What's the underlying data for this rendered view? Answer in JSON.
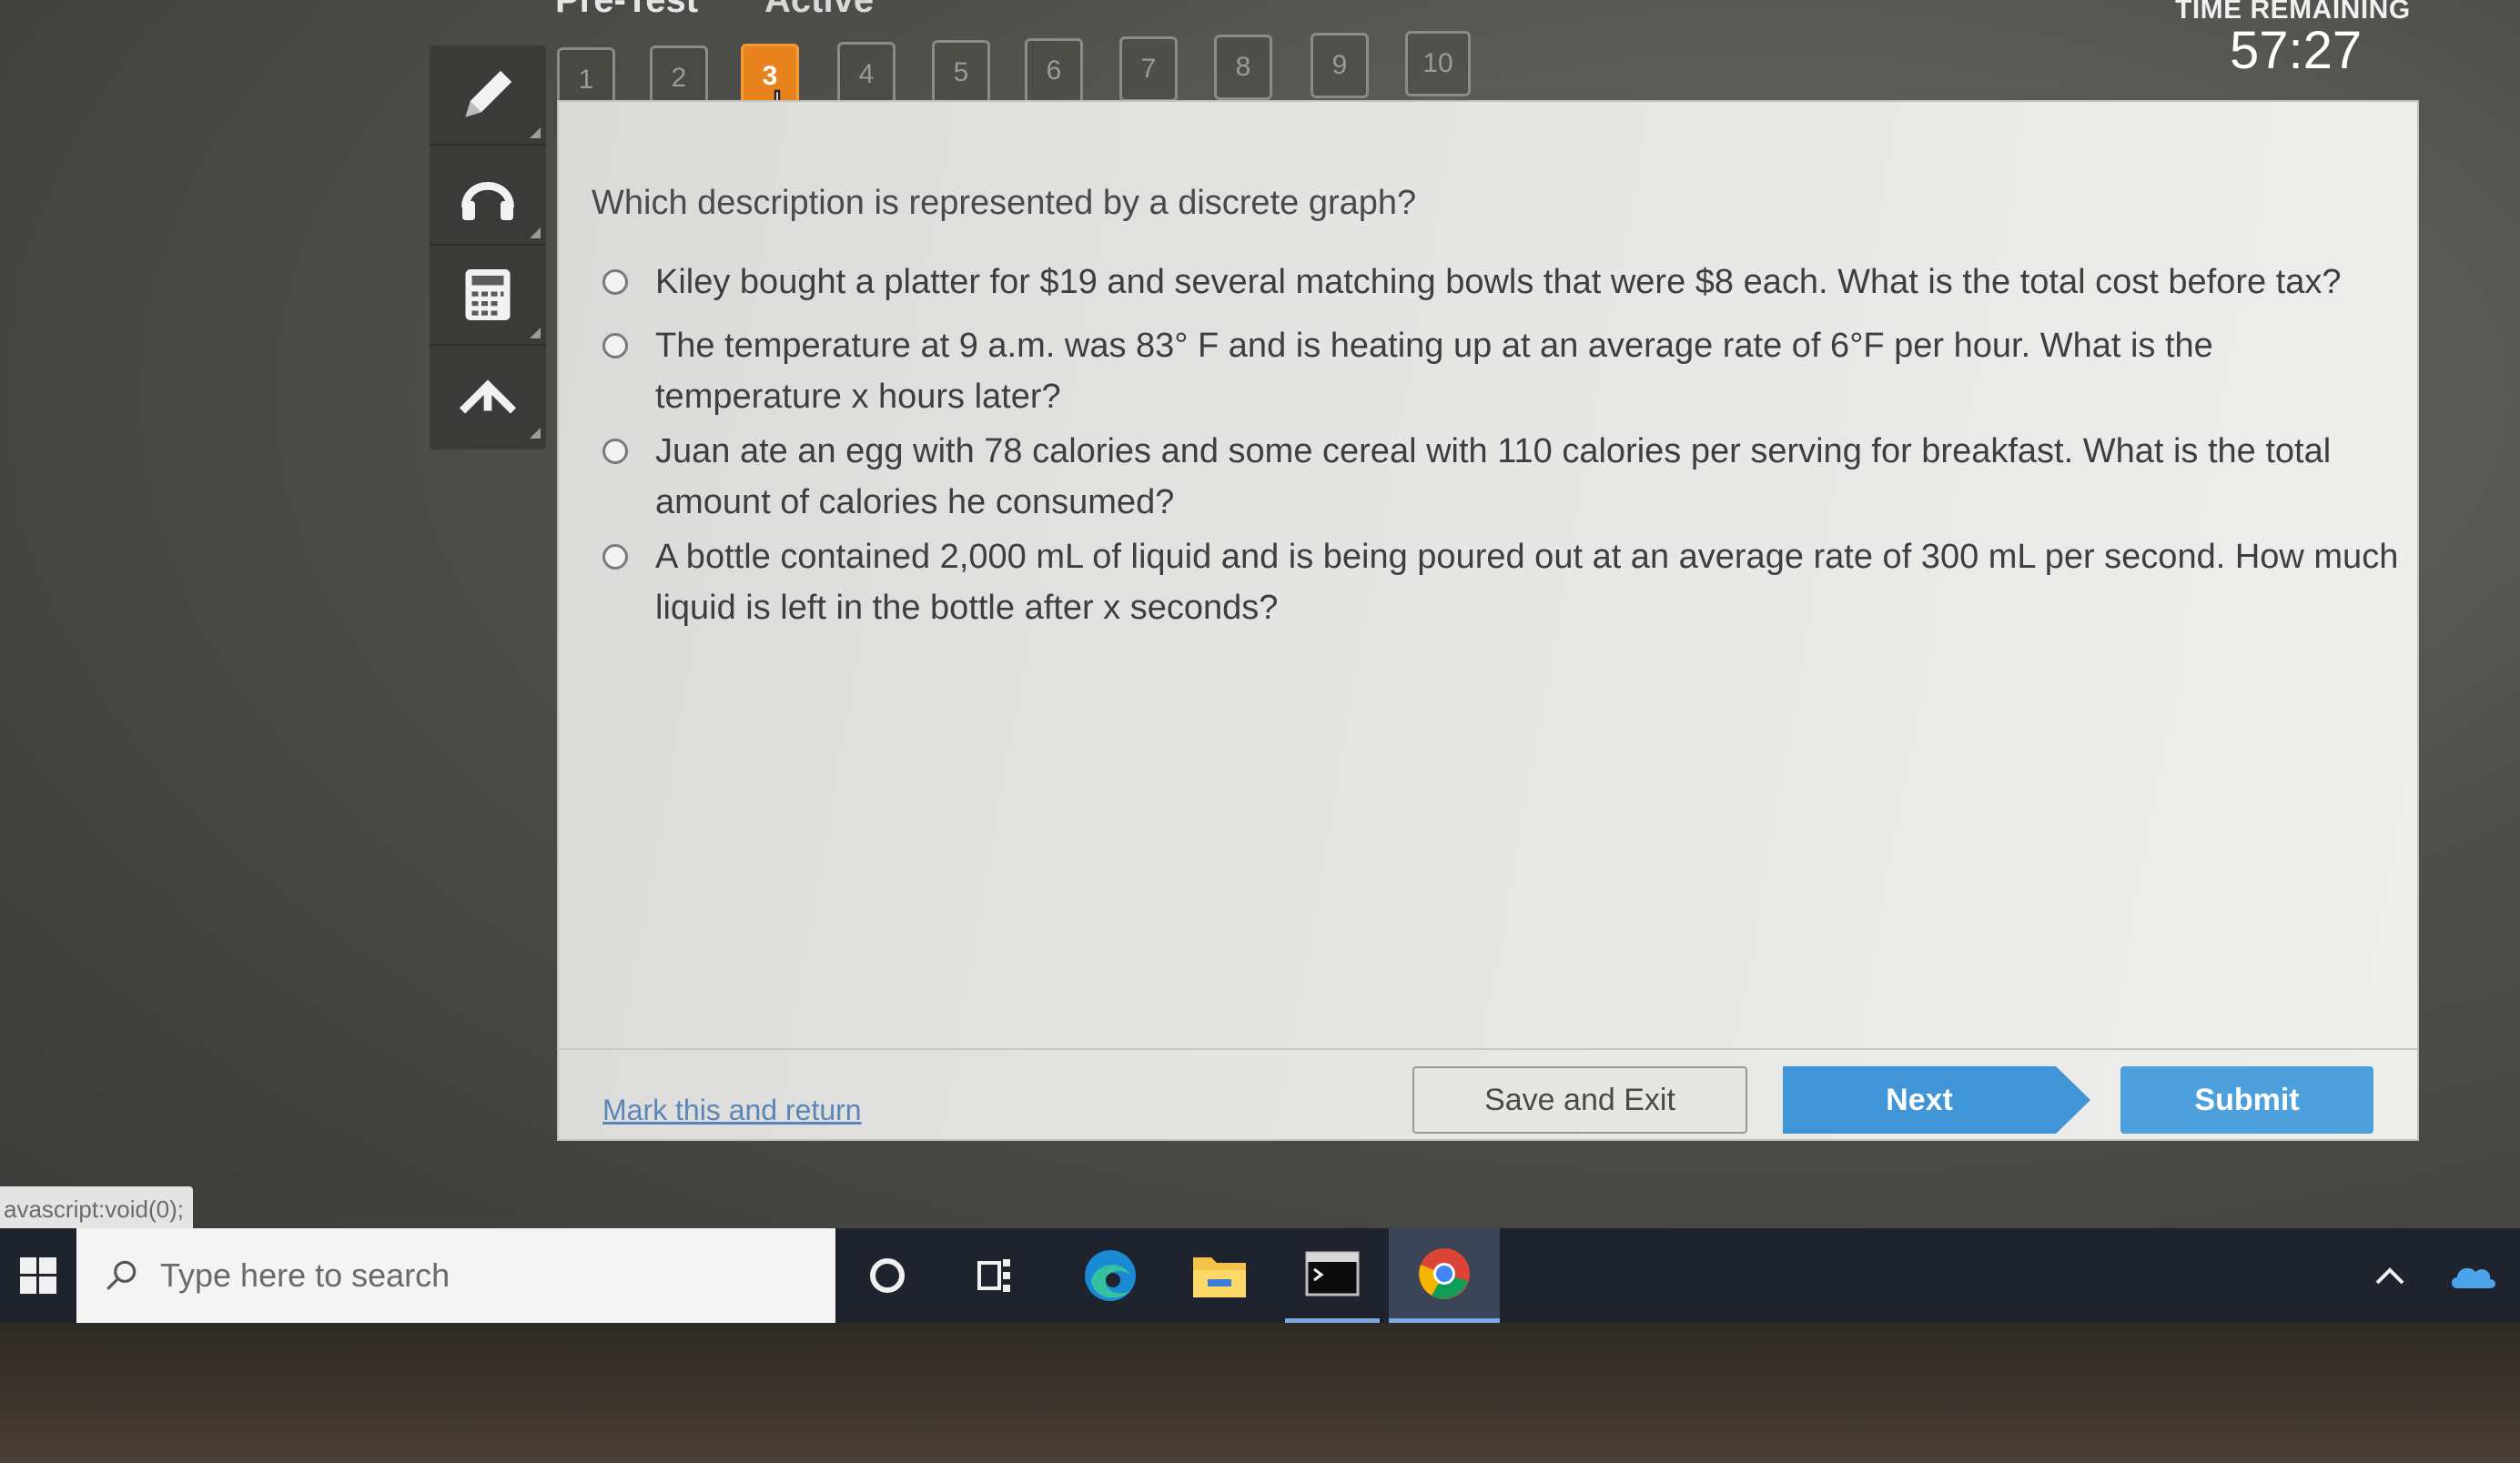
{
  "header": {
    "title": "Pre-Test",
    "subtitle": "Active",
    "timer_label": "TIME REMAINING",
    "timer_value": "57:27"
  },
  "question_nav": {
    "current": 3,
    "items": [
      "1",
      "2",
      "3",
      "4",
      "5",
      "6",
      "7",
      "8",
      "9",
      "10"
    ]
  },
  "toolbar": {
    "tools": [
      "pencil-icon",
      "headphones-icon",
      "calculator-icon",
      "collapse-icon"
    ]
  },
  "question": {
    "prompt": "Which description is represented by a discrete graph?",
    "options": [
      "Kiley bought a platter for $19 and several matching bowls that were $8 each. What is the total cost before tax?",
      "The temperature at 9 a.m. was 83° F and is heating up at an average rate of  6°F per hour. What is the temperature x hours later?",
      "Juan ate an egg with 78 calories and some cereal with 110 calories per serving for breakfast. What is the total amount of calories he consumed?",
      "A bottle contained 2,000 mL of liquid and is being poured out at an average rate of 300 mL per second. How much liquid is left in the bottle after x seconds?"
    ]
  },
  "footer": {
    "mark_link": "Mark this and return",
    "save_label": "Save and Exit",
    "next_label": "Next",
    "submit_label": "Submit"
  },
  "status_bar": {
    "url": "avascript:void(0);"
  },
  "taskbar": {
    "search_placeholder": "Type here to search"
  },
  "colors": {
    "active_question": "#e8821c",
    "primary_button": "#3f95d6",
    "taskbar": "#1e232d"
  }
}
